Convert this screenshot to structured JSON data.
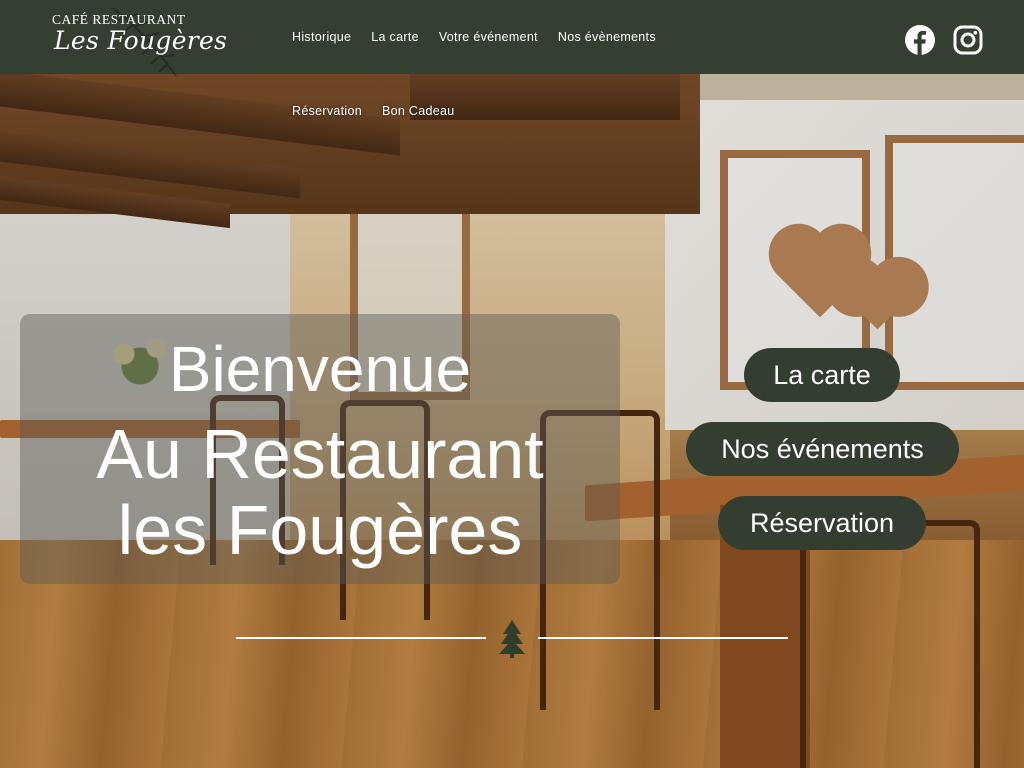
{
  "brand": {
    "line1": "CAFÉ RESTAURANT",
    "line2": "Les Fougères"
  },
  "nav": {
    "primary": [
      "Historique",
      "La carte",
      "Votre événement",
      "Nos évènements"
    ],
    "secondary": [
      "Réservation",
      "Bon Cadeau"
    ]
  },
  "social": {
    "facebook_icon": "facebook-icon",
    "instagram_icon": "instagram-icon"
  },
  "hero": {
    "greeting": "Bienvenue",
    "title_line1": "Au Restaurant",
    "title_line2": "les Fougères"
  },
  "cta": {
    "carte": "La carte",
    "events": "Nos événements",
    "reservation": "Réservation"
  },
  "colors": {
    "header_bg": "#343e31",
    "button_bg": "#333d30",
    "text": "#ffffff"
  }
}
